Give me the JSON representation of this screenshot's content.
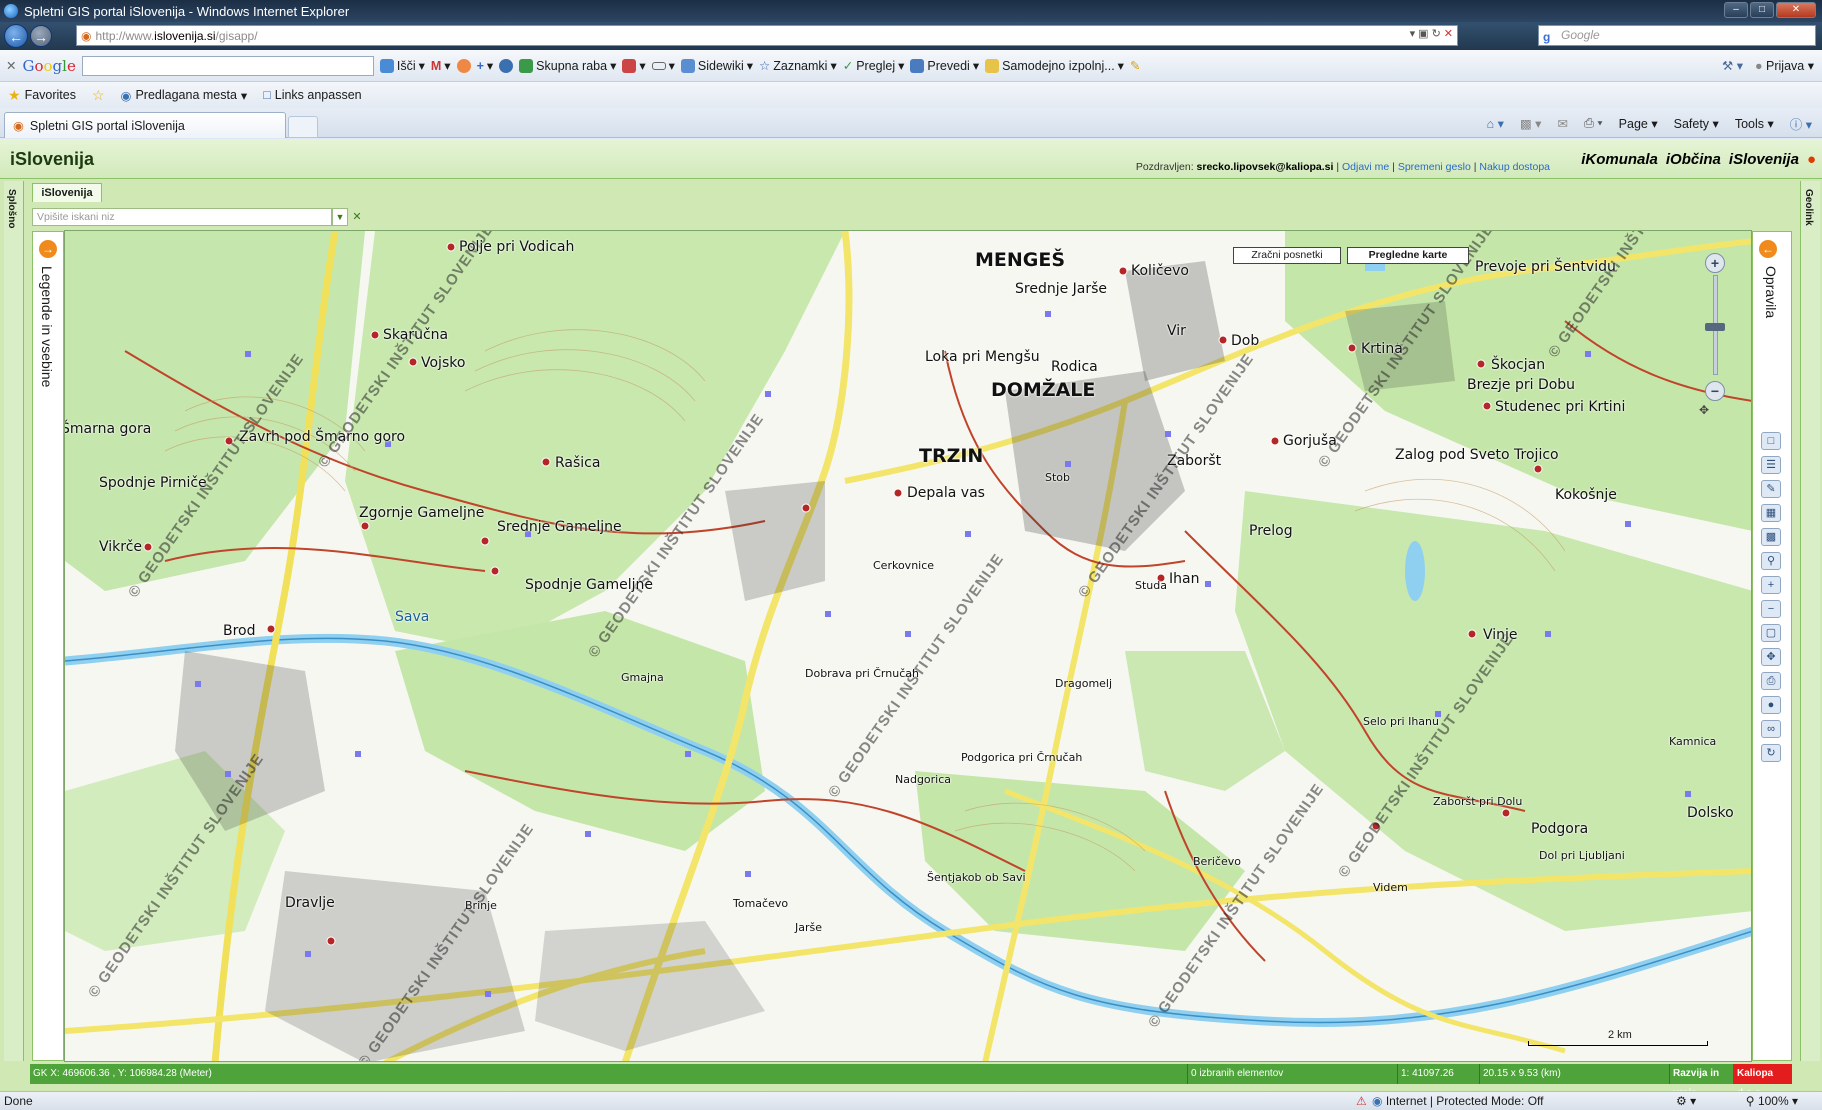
{
  "window": {
    "title": "Spletni GIS portal iSlovenija - Windows Internet Explorer",
    "controls": [
      "–",
      "□",
      "✕"
    ]
  },
  "addressbar": {
    "url_prefix": "http://www.",
    "url_domain": "islovenija.si",
    "url_path": "/gisapp/",
    "search_placeholder": "Google"
  },
  "google_toolbar": {
    "items": [
      "Išči",
      "Skupna raba",
      "Sidewiki",
      "Zaznamki",
      "Preglej",
      "Prevedi",
      "Samodejno izpolnj..."
    ],
    "signin": "Prijava"
  },
  "favorites": {
    "label": "Favorites",
    "items": [
      "Predlagana mesta",
      "Links anpassen"
    ]
  },
  "tab": {
    "title": "Spletni GIS portal iSlovenija"
  },
  "commandbar": [
    "Page",
    "Safety",
    "Tools"
  ],
  "app": {
    "brand": "iSlovenija",
    "greeting": "Pozdravljen:",
    "user": "srecko.lipovsek@kaliopa.si",
    "links": [
      "Odjavi me",
      "Spremeni geslo",
      "Nakup dostopa"
    ],
    "logos": [
      "iKomunala",
      "iObčina",
      "iSlovenija"
    ],
    "left_side_label": "Splošno",
    "right_side_label": "Geolink",
    "inner_tab": "iSlovenija",
    "search_placeholder": "Vpišite iskani niz",
    "legend_label": "Legende in vsebine",
    "tools_label": "Opravila",
    "map_buttons": [
      "Zračni posnetki",
      "Pregledne karte"
    ],
    "scale_label": "2 km",
    "watermark": "© GEODETSKI INŠTITUT SLOVENIJE"
  },
  "map_places": [
    {
      "name": "MENGEŠ",
      "size": "big"
    },
    {
      "name": "DOMŽALE",
      "size": "big"
    },
    {
      "name": "TRZIN",
      "size": "big"
    },
    {
      "name": "Polje pri Vodicah",
      "size": "mid"
    },
    {
      "name": "Srednje Jarše",
      "size": "mid"
    },
    {
      "name": "Količevo",
      "size": "mid"
    },
    {
      "name": "Prevoje pri Šentvidu",
      "size": "mid"
    },
    {
      "name": "Skaručna",
      "size": "mid"
    },
    {
      "name": "Vojsko",
      "size": "mid"
    },
    {
      "name": "Loka pri Mengšu",
      "size": "mid"
    },
    {
      "name": "Rodica",
      "size": "mid"
    },
    {
      "name": "Dob",
      "size": "mid"
    },
    {
      "name": "Krtina",
      "size": "mid"
    },
    {
      "name": "Vir",
      "size": "mid"
    },
    {
      "name": "Škocjan",
      "size": "mid"
    },
    {
      "name": "Brezje pri Dobu",
      "size": "mid"
    },
    {
      "name": "Studenec pri Krtini",
      "size": "mid"
    },
    {
      "name": "Zavrh pod Šmarno goro",
      "size": "mid"
    },
    {
      "name": "Rašica",
      "size": "mid"
    },
    {
      "name": "Gorjuša",
      "size": "mid"
    },
    {
      "name": "Zaboršt",
      "size": "mid"
    },
    {
      "name": "Zalog pod Sveto Trojico",
      "size": "mid"
    },
    {
      "name": "Spodnje Pirniče",
      "size": "mid"
    },
    {
      "name": "Zgornje Gameljne",
      "size": "mid"
    },
    {
      "name": "Srednje Gameljne",
      "size": "mid"
    },
    {
      "name": "Depala vas",
      "size": "mid"
    },
    {
      "name": "Kokošnje",
      "size": "mid"
    },
    {
      "name": "Vikrče",
      "size": "mid"
    },
    {
      "name": "Spodnje Gameljne",
      "size": "mid"
    },
    {
      "name": "Prelog",
      "size": "mid"
    },
    {
      "name": "Ihan",
      "size": "mid"
    },
    {
      "name": "Brod",
      "size": "mid"
    },
    {
      "name": "Vinje",
      "size": "mid"
    },
    {
      "name": "Dragomelj",
      "size": "small"
    },
    {
      "name": "Podgorica pri Črnučah",
      "size": "small"
    },
    {
      "name": "Selo pri Ihanu",
      "size": "small"
    },
    {
      "name": "Kamnica",
      "size": "small"
    },
    {
      "name": "Zaboršt pri Dolu",
      "size": "small"
    },
    {
      "name": "Podgora",
      "size": "mid"
    },
    {
      "name": "Dolsko",
      "size": "mid"
    },
    {
      "name": "Beričevo",
      "size": "small"
    },
    {
      "name": "Dol pri Ljubljani",
      "size": "small"
    },
    {
      "name": "Videm",
      "size": "small"
    },
    {
      "name": "Dravlje",
      "size": "mid"
    },
    {
      "name": "Šentjakob ob Savi",
      "size": "small"
    },
    {
      "name": "Tomačevo",
      "size": "small"
    },
    {
      "name": "Brinje",
      "size": "small"
    },
    {
      "name": "Jarše",
      "size": "small"
    },
    {
      "name": "Nadgorica",
      "size": "small"
    },
    {
      "name": "Dobrava pri Črnučah",
      "size": "small"
    },
    {
      "name": "Gmajna",
      "size": "small"
    },
    {
      "name": "Sava",
      "size": "mid"
    },
    {
      "name": "Cerkovnice",
      "size": "small"
    },
    {
      "name": "Stob",
      "size": "small"
    },
    {
      "name": "Studa",
      "size": "small"
    },
    {
      "name": "Šmarna gora",
      "size": "mid"
    }
  ],
  "status": {
    "coords": "GK X: 469606.36 , Y: 106984.28 (Meter)",
    "selected": "0 izbranih elementov",
    "scale": "1: 41097.26",
    "extent": "20.15 x 9.53 (km)",
    "dev": "Razvija in ureja",
    "company": "Kaliopa d.o.o."
  },
  "ie_status": {
    "left": "Done",
    "zone": "Internet | Protected Mode: Off",
    "zoom": "100%"
  }
}
